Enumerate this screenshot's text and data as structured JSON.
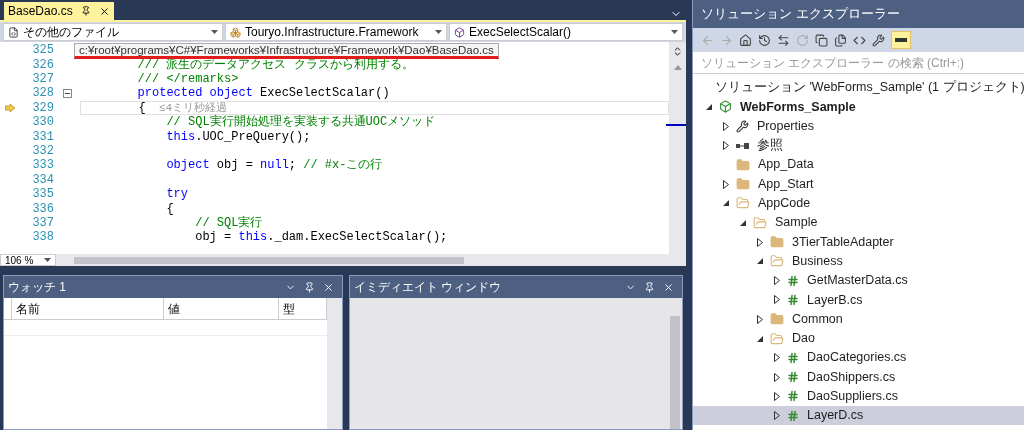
{
  "editor": {
    "tabs": [
      {
        "label": "BaseDao.cs",
        "selected": true
      }
    ],
    "nav": {
      "file": "その他のファイル",
      "namespace": "Touryo.Infrastructure.Framework",
      "member": "ExecSelectScalar()"
    },
    "path_tooltip": "c:¥root¥programs¥C#¥Frameworks¥Infrastructure¥Framework¥Dao¥BaseDao.cs",
    "lines": [
      {
        "number": "325",
        "current": false,
        "foldable": false
      },
      {
        "number": "326",
        "current": false,
        "foldable": false,
        "tokens": [
          {
            "kind": "comment",
            "text": "        /// 派生のデータアクセス クラスから利用する。"
          }
        ]
      },
      {
        "number": "327",
        "current": false,
        "foldable": false,
        "tokens": [
          {
            "kind": "comment",
            "text": "        /// </remarks>"
          }
        ]
      },
      {
        "number": "328",
        "current": false,
        "foldable": true,
        "tokens": [
          {
            "kind": "keyword",
            "text": "        protected object"
          },
          {
            "kind": "plain",
            "text": " ExecSelectScalar()"
          }
        ]
      },
      {
        "number": "329",
        "current": true,
        "foldable": false,
        "tokens": [
          {
            "kind": "plain",
            "text": "        {"
          },
          {
            "kind": "hint",
            "text": "  ≤4ミリ秒経過"
          }
        ]
      },
      {
        "number": "330",
        "current": false,
        "foldable": false,
        "tokens": [
          {
            "kind": "comment",
            "text": "            // SQL実行開始処理を実装する共通UOCメソッド"
          }
        ]
      },
      {
        "number": "331",
        "current": false,
        "foldable": false,
        "tokens": [
          {
            "kind": "keyword",
            "text": "            this"
          },
          {
            "kind": "plain",
            "text": ".UOC_PreQuery();"
          }
        ]
      },
      {
        "number": "332",
        "current": false,
        "foldable": false
      },
      {
        "number": "333",
        "current": false,
        "foldable": false,
        "tokens": [
          {
            "kind": "keyword",
            "text": "            object"
          },
          {
            "kind": "plain",
            "text": " obj = "
          },
          {
            "kind": "keyword",
            "text": "null"
          },
          {
            "kind": "plain",
            "text": "; "
          },
          {
            "kind": "comment",
            "text": "// #x-この行"
          }
        ]
      },
      {
        "number": "334",
        "current": false,
        "foldable": false
      },
      {
        "number": "335",
        "current": false,
        "foldable": false,
        "tokens": [
          {
            "kind": "keyword",
            "text": "            try"
          }
        ]
      },
      {
        "number": "336",
        "current": false,
        "foldable": false,
        "tokens": [
          {
            "kind": "plain",
            "text": "            {"
          }
        ]
      },
      {
        "number": "337",
        "current": false,
        "foldable": false,
        "tokens": [
          {
            "kind": "comment",
            "text": "                // SQL実行"
          }
        ]
      },
      {
        "number": "338",
        "current": false,
        "foldable": false,
        "tokens": [
          {
            "kind": "plain",
            "text": "                obj = "
          },
          {
            "kind": "keyword",
            "text": "this"
          },
          {
            "kind": "plain",
            "text": "._dam.ExecSelectScalar();"
          }
        ]
      }
    ],
    "zoom": "106 %"
  },
  "watch": {
    "title": "ウォッチ 1",
    "columns": [
      "名前",
      "値",
      "型"
    ]
  },
  "immediate": {
    "title": "イミディエイト ウィンドウ"
  },
  "solution_explorer": {
    "title": "ソリューション エクスプローラー",
    "preview_on": true,
    "search_placeholder": "ソリューション エクスプローラー の検索 (Ctrl+:)",
    "tree": [
      {
        "kind": "solution",
        "label": "ソリューション 'WebForms_Sample' (1 プロジェクト)",
        "selected": false,
        "children": [
          {
            "kind": "project",
            "label": "WebForms_Sample",
            "expanded": true,
            "selected": false,
            "children": [
              {
                "kind": "properties",
                "label": "Properties",
                "expanded": false,
                "selected": false
              },
              {
                "kind": "references",
                "label": "参照",
                "expanded": false,
                "selected": false
              },
              {
                "kind": "folder",
                "label": "App_Data",
                "selected": false
              },
              {
                "kind": "folder",
                "label": "App_Start",
                "expanded": false,
                "selected": false
              },
              {
                "kind": "folder",
                "label": "AppCode",
                "expanded": true,
                "selected": false,
                "children": [
                  {
                    "kind": "folder",
                    "label": "Sample",
                    "expanded": true,
                    "selected": false,
                    "children": [
                      {
                        "kind": "folder",
                        "label": "3TierTableAdapter",
                        "expanded": false,
                        "selected": false
                      },
                      {
                        "kind": "folder",
                        "label": "Business",
                        "expanded": true,
                        "selected": false,
                        "children": [
                          {
                            "kind": "csfile",
                            "label": "GetMasterData.cs",
                            "expanded": false,
                            "selected": false
                          },
                          {
                            "kind": "csfile",
                            "label": "LayerB.cs",
                            "expanded": false,
                            "selected": false
                          }
                        ]
                      },
                      {
                        "kind": "folder",
                        "label": "Common",
                        "expanded": false,
                        "selected": false
                      },
                      {
                        "kind": "folder",
                        "label": "Dao",
                        "expanded": true,
                        "selected": false,
                        "children": [
                          {
                            "kind": "csfile",
                            "label": "DaoCategories.cs",
                            "expanded": false,
                            "selected": false
                          },
                          {
                            "kind": "csfile",
                            "label": "DaoShippers.cs",
                            "expanded": false,
                            "selected": false
                          },
                          {
                            "kind": "csfile",
                            "label": "DaoSuppliers.cs",
                            "expanded": false,
                            "selected": false
                          },
                          {
                            "kind": "csfile",
                            "label": "LayerD.cs",
                            "expanded": false,
                            "selected": true
                          }
                        ]
                      }
                    ]
                  }
                ]
              }
            ]
          }
        ]
      }
    ]
  }
}
